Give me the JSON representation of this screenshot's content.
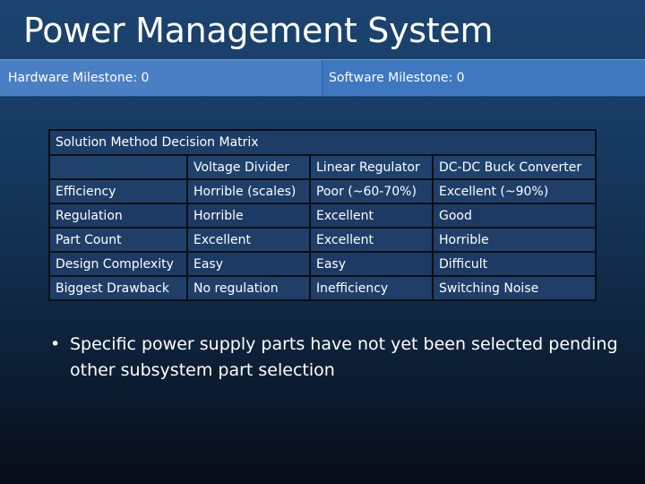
{
  "slide": {
    "title": "Power Management System",
    "hardware_milestone": "Hardware Milestone: 0",
    "software_milestone": "Software Milestone: 0"
  },
  "matrix": {
    "caption": "Solution Method Decision Matrix",
    "columns": [
      "",
      "Voltage Divider",
      "Linear Regulator",
      "DC-DC Buck Converter"
    ],
    "rows": [
      [
        "Efficiency",
        "Horrible (scales)",
        "Poor (~60-70%)",
        "Excellent (~90%)"
      ],
      [
        "Regulation",
        "Horrible",
        "Excellent",
        "Good"
      ],
      [
        "Part Count",
        "Excellent",
        "Excellent",
        "Horrible"
      ],
      [
        "Design Complexity",
        "Easy",
        "Easy",
        "Difficult"
      ],
      [
        "Biggest Drawback",
        "No regulation",
        "Inefficiency",
        "Switching Noise"
      ]
    ]
  },
  "bullets": [
    "Specific power supply parts have not yet been selected pending other subsystem part selection"
  ],
  "colors": {
    "background_top": "#1c4470",
    "background_bottom": "#070d18",
    "milestone_bar": "#3f78c0",
    "text": "#ffffff"
  }
}
